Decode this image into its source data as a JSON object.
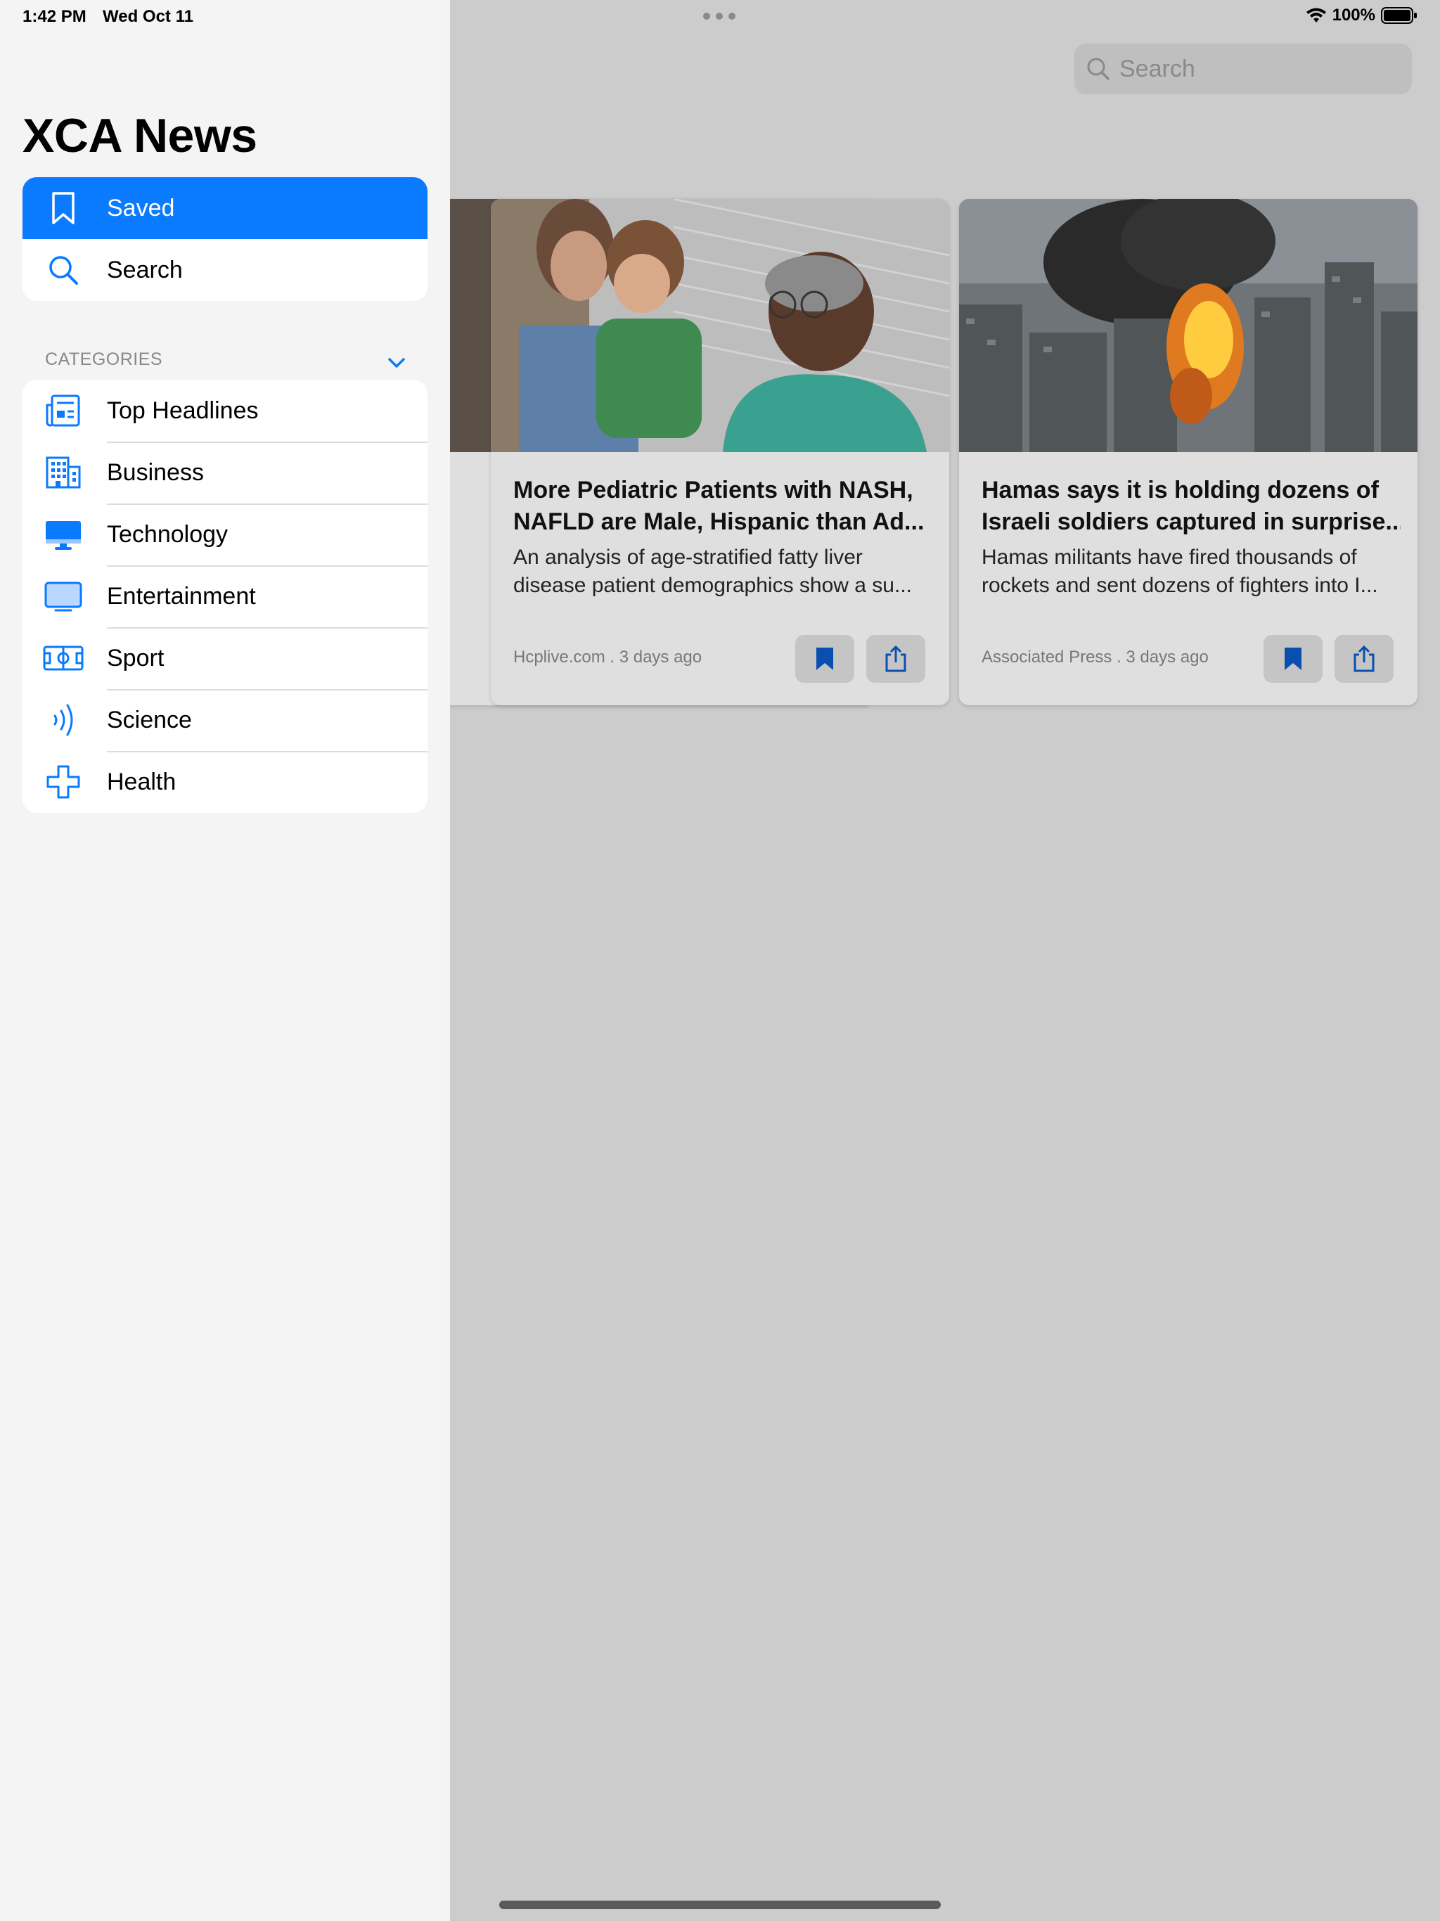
{
  "status_bar": {
    "time": "1:42 PM",
    "date": "Wed Oct 11",
    "battery": "100%"
  },
  "sidebar": {
    "title": "XCA News",
    "top_items": [
      {
        "label": "Saved",
        "icon": "bookmark-icon",
        "selected": true
      },
      {
        "label": "Search",
        "icon": "search-icon",
        "selected": false
      }
    ],
    "categories_header": "CATEGORIES",
    "categories": [
      {
        "label": "Top Headlines",
        "icon": "newspaper-icon"
      },
      {
        "label": "Business",
        "icon": "building-icon"
      },
      {
        "label": "Technology",
        "icon": "desktop-computer-icon"
      },
      {
        "label": "Entertainment",
        "icon": "tv-icon"
      },
      {
        "label": "Sport",
        "icon": "sports-field-icon"
      },
      {
        "label": "Science",
        "icon": "wave-icon"
      },
      {
        "label": "Health",
        "icon": "cross-icon"
      }
    ]
  },
  "main": {
    "search_placeholder": "Search",
    "articles": [
      {
        "title_line1": "More Pediatric Patients with NASH,",
        "title_line2": "NAFLD are Male, Hispanic than Ad...",
        "desc_line1": "An analysis of age-stratified fatty liver",
        "desc_line2": "disease patient demographics show a su...",
        "meta": "Hcplive.com . 3 days ago",
        "image": "doctor-with-child-photo"
      },
      {
        "title_line1": "Hamas says it is holding dozens of",
        "title_line2": "Israeli soldiers captured in surprise...",
        "desc_line1": "Hamas militants have fired thousands of",
        "desc_line2": "rockets and sent dozens of fighters into I...",
        "meta": "Associated Press . 3 days ago",
        "image": "city-explosion-photo"
      }
    ]
  },
  "colors": {
    "accent": "#0a7aff",
    "sidebar_bg": "#f4f4f4",
    "content_dim_bg": "#cccccc",
    "card_bg": "#dfdfdf",
    "bookmark_dim": "#0a4fb0"
  }
}
